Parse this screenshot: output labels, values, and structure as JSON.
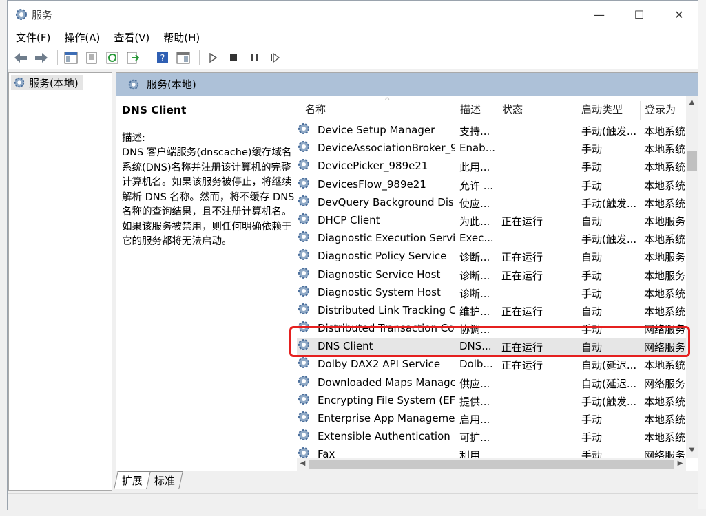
{
  "window": {
    "title": "服务",
    "controls": {
      "minimize": "—",
      "maximize": "☐",
      "close": "✕"
    }
  },
  "menu": [
    "文件(F)",
    "操作(A)",
    "查看(V)",
    "帮助(H)"
  ],
  "toolbar": [
    "back-icon",
    "forward-icon",
    "console-tree-icon",
    "properties-icon",
    "refresh-icon",
    "export-icon",
    "help-icon",
    "view-icon",
    "play-icon",
    "stop-icon",
    "pause-icon",
    "restart-icon"
  ],
  "tree": {
    "root_label": "服务(本地)"
  },
  "pane": {
    "header": "服务(本地)"
  },
  "detail": {
    "service_name": "DNS Client",
    "desc_label": "描述:",
    "description": "DNS 客户端服务(dnscache)缓存域名系统(DNS)名称并注册该计算机的完整计算机名。如果该服务被停止，将继续解析 DNS 名称。然而，将不缓存 DNS 名称的查询结果，且不注册计算机名。如果该服务被禁用，则任何明确依赖于它的服务都将无法启动。"
  },
  "columns": {
    "name": "名称",
    "desc": "描述",
    "status": "状态",
    "startup": "启动类型",
    "logon": "登录为"
  },
  "rows": [
    {
      "name": "Device Setup Manager",
      "desc": "支持...",
      "status": "",
      "startup": "手动(触发...",
      "logon": "本地系统"
    },
    {
      "name": "DeviceAssociationBroker_9...",
      "desc": "Enab...",
      "status": "",
      "startup": "手动",
      "logon": "本地系统"
    },
    {
      "name": "DevicePicker_989e21",
      "desc": "此用...",
      "status": "",
      "startup": "手动",
      "logon": "本地系统"
    },
    {
      "name": "DevicesFlow_989e21",
      "desc": "允许 ...",
      "status": "",
      "startup": "手动",
      "logon": "本地系统"
    },
    {
      "name": "DevQuery Background Dis...",
      "desc": "使应...",
      "status": "",
      "startup": "手动(触发...",
      "logon": "本地系统"
    },
    {
      "name": "DHCP Client",
      "desc": "为此...",
      "status": "正在运行",
      "startup": "自动",
      "logon": "本地服务"
    },
    {
      "name": "Diagnostic Execution Service",
      "desc": "Exec...",
      "status": "",
      "startup": "手动(触发...",
      "logon": "本地系统"
    },
    {
      "name": "Diagnostic Policy Service",
      "desc": "诊断...",
      "status": "正在运行",
      "startup": "自动",
      "logon": "本地服务"
    },
    {
      "name": "Diagnostic Service Host",
      "desc": "诊断...",
      "status": "正在运行",
      "startup": "手动",
      "logon": "本地服务"
    },
    {
      "name": "Diagnostic System Host",
      "desc": "诊断...",
      "status": "",
      "startup": "手动",
      "logon": "本地系统"
    },
    {
      "name": "Distributed Link Tracking C...",
      "desc": "维护...",
      "status": "正在运行",
      "startup": "自动",
      "logon": "本地系统"
    },
    {
      "name": "Distributed Transaction Co...",
      "desc": "协调...",
      "status": "",
      "startup": "手动",
      "logon": "网络服务"
    },
    {
      "name": "DNS Client",
      "desc": "DNS...",
      "status": "正在运行",
      "startup": "自动",
      "logon": "网络服务"
    },
    {
      "name": "Dolby DAX2 API Service",
      "desc": "Dolb...",
      "status": "正在运行",
      "startup": "自动(延迟...",
      "logon": "本地系统"
    },
    {
      "name": "Downloaded Maps Manager",
      "desc": "供应...",
      "status": "",
      "startup": "自动(延迟...",
      "logon": "网络服务"
    },
    {
      "name": "Encrypting File System (EFS)",
      "desc": "提供...",
      "status": "",
      "startup": "手动(触发...",
      "logon": "本地系统"
    },
    {
      "name": "Enterprise App Manageme...",
      "desc": "启用...",
      "status": "",
      "startup": "手动",
      "logon": "本地系统"
    },
    {
      "name": "Extensible Authentication ...",
      "desc": "可扩...",
      "status": "",
      "startup": "手动",
      "logon": "本地系统"
    },
    {
      "name": "Fax",
      "desc": "利用...",
      "status": "",
      "startup": "手动",
      "logon": "网络服务"
    }
  ],
  "tabs": [
    "扩展",
    "标准"
  ],
  "colors": {
    "header_blue": "#adc1d8",
    "highlight_red": "#e5201f"
  }
}
